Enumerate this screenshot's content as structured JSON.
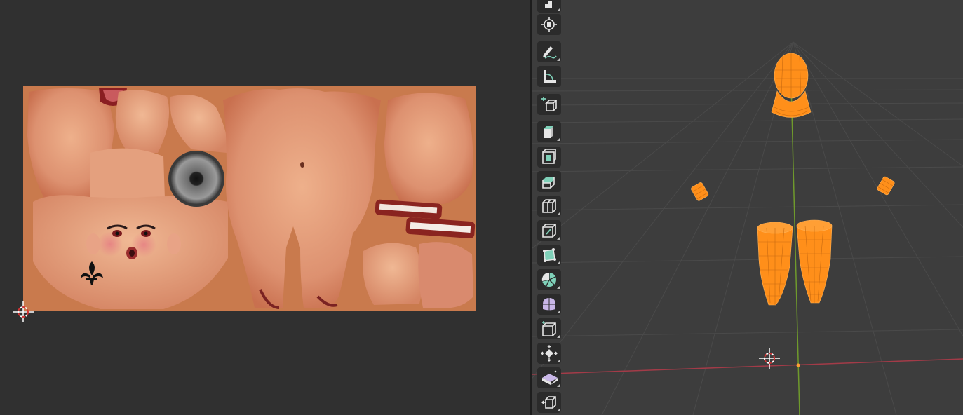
{
  "app": {
    "uv_editor": {
      "image": {
        "background_color": "#c97a4d",
        "skin_tone": "#e7a480",
        "eye_color": "#5a5a5a",
        "icons": [
          "fleur-de-lis-tattoo-icon"
        ]
      },
      "cursor_icon": "2d-cursor-icon"
    },
    "viewport": {
      "grid_color": "#4a4a4a",
      "x_axis_color": "#a33b48",
      "y_axis_color": "#6f9a2c",
      "selection_color": "#ff8f1a",
      "cursor_icon": "3d-cursor-icon",
      "toolbar": {
        "tools": [
          {
            "name": "select-box-tool",
            "icon": "select-box-icon"
          },
          {
            "name": "cursor-tool",
            "icon": "cursor-icon"
          },
          {
            "name": "annotate-tool",
            "icon": "annotate-pencil-icon"
          },
          {
            "name": "measure-tool",
            "icon": "measure-ruler-icon"
          },
          {
            "name": "add-cube-tool",
            "icon": "add-cube-icon"
          },
          {
            "name": "extrude-region-tool",
            "icon": "extrude-region-icon"
          },
          {
            "name": "inset-faces-tool",
            "icon": "inset-faces-icon"
          },
          {
            "name": "bevel-tool",
            "icon": "bevel-icon"
          },
          {
            "name": "loop-cut-tool",
            "icon": "loop-cut-icon"
          },
          {
            "name": "knife-tool",
            "icon": "knife-icon"
          },
          {
            "name": "poly-build-tool",
            "icon": "poly-build-icon"
          },
          {
            "name": "spin-tool",
            "icon": "spin-icon"
          },
          {
            "name": "smooth-tool",
            "icon": "smooth-vertices-icon"
          },
          {
            "name": "edge-slide-tool",
            "icon": "edge-slide-icon"
          },
          {
            "name": "shrink-fatten-tool",
            "icon": "shrink-fatten-icon"
          },
          {
            "name": "shear-tool",
            "icon": "shear-icon"
          },
          {
            "name": "rip-region-tool",
            "icon": "rip-region-icon"
          }
        ]
      }
    }
  }
}
